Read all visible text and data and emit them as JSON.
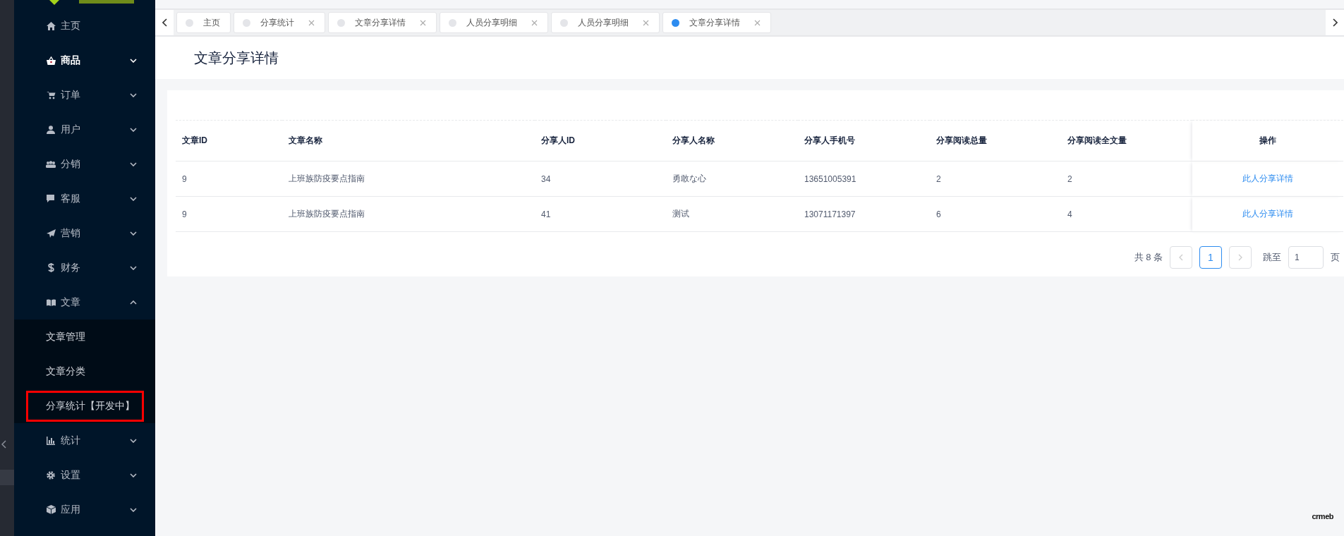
{
  "sidebar": {
    "items": [
      {
        "label": "主页",
        "active": false
      },
      {
        "label": "商品",
        "active": true,
        "expanded": false
      },
      {
        "label": "订单",
        "active": false,
        "expanded": false
      },
      {
        "label": "用户",
        "active": false,
        "expanded": false
      },
      {
        "label": "分销",
        "active": false,
        "expanded": false
      },
      {
        "label": "客服",
        "active": false,
        "expanded": false
      },
      {
        "label": "营销",
        "active": false,
        "expanded": false
      },
      {
        "label": "财务",
        "active": false,
        "expanded": false
      },
      {
        "label": "文章",
        "active": false,
        "expanded": true,
        "children": [
          {
            "label": "文章管理",
            "outlined": false
          },
          {
            "label": "文章分类",
            "outlined": false
          },
          {
            "label": "分享统计【开发中】",
            "outlined": true
          }
        ]
      },
      {
        "label": "统计",
        "active": false,
        "expanded": false
      },
      {
        "label": "设置",
        "active": false,
        "expanded": false
      },
      {
        "label": "应用",
        "active": false,
        "expanded": false
      }
    ]
  },
  "tabs": [
    {
      "label": "主页",
      "closable": false,
      "selected": false
    },
    {
      "label": "分享统计",
      "closable": true,
      "selected": false
    },
    {
      "label": "文章分享详情",
      "closable": true,
      "selected": false
    },
    {
      "label": "人员分享明细",
      "closable": true,
      "selected": false
    },
    {
      "label": "人员分享明细",
      "closable": true,
      "selected": false
    },
    {
      "label": "文章分享详情",
      "closable": true,
      "selected": true
    }
  ],
  "page_title": "文章分享详情",
  "table": {
    "columns": [
      "文章ID",
      "文章名称",
      "分享人ID",
      "分享人名称",
      "分享人手机号",
      "分享阅读总量",
      "分享阅读全文量",
      "操作"
    ],
    "rows": [
      {
        "cells": [
          "9",
          "上班族防疫要点指南",
          "34",
          "勇敢な心",
          "13651005391",
          "2",
          "2"
        ],
        "action": "此人分享详情"
      },
      {
        "cells": [
          "9",
          "上班族防疫要点指南",
          "41",
          "测试",
          "13071171397",
          "6",
          "4"
        ],
        "action": "此人分享详情"
      }
    ]
  },
  "pagination": {
    "total": "共 8 条",
    "pages": [
      {
        "label": "1",
        "selected": true
      }
    ],
    "jump_label": "跳至",
    "jump_value": "1",
    "suffix": "页"
  },
  "footer_logo": "crmeb"
}
